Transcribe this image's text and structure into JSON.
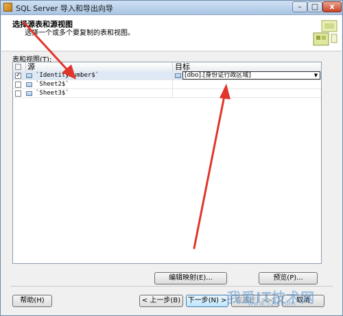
{
  "window": {
    "title": "SQL Server 导入和导出向导"
  },
  "header": {
    "title": "选择源表和源视图",
    "subtitle": "选择一个或多个要复制的表和视图。"
  },
  "list": {
    "label": "表和视图(T):",
    "columns": {
      "source": "源",
      "target": "目标"
    },
    "rows": [
      {
        "checked": true,
        "source": "`IdentityNumber$`",
        "target": "[dbo].[身份证行政区域]"
      },
      {
        "checked": false,
        "source": "`Sheet2$`",
        "target": ""
      },
      {
        "checked": false,
        "source": "`Sheet3$`",
        "target": ""
      }
    ]
  },
  "buttons": {
    "edit_mapping": "编辑映射(E)...",
    "preview": "预览(P)...",
    "help": "帮助(H)",
    "back": "< 上一步(B)",
    "next": "下一步(N) >",
    "finish": "完成(F) >>|",
    "cancel": "取消"
  },
  "watermark": {
    "text": "我爱IT技术网",
    "url": "www.52ij.com"
  },
  "colors": {
    "annotation_arrow": "#e0352b"
  }
}
